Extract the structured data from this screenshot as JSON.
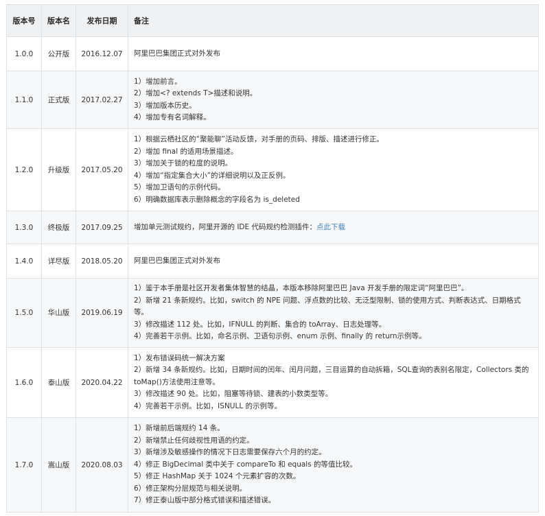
{
  "headers": {
    "version": "版本号",
    "name": "版本名",
    "date": "发布日期",
    "note": "备注"
  },
  "rows": [
    {
      "version": "1.0.0",
      "name": "公开版",
      "date": "2016.12.07",
      "notes": [
        "阿里巴巴集团正式对外发布"
      ]
    },
    {
      "version": "1.1.0",
      "name": "正式版",
      "date": "2017.02.27",
      "notes": [
        "1）增加前言。",
        "2）增加<? extends T>描述和说明。",
        "3）增加版本历史。",
        "4）增加专有名词解释。"
      ]
    },
    {
      "version": "1.2.0",
      "name": "升级版",
      "date": "2017.05.20",
      "notes": [
        "1）根据云栖社区的“聚能聊”活动反馈，对手册的页码、排版、描述进行修正。",
        "2）增加 final 的适用场景描述。",
        "3）增加关于锁的粒度的说明。",
        "4）增加“指定集合大小”的详细说明以及正反例。",
        "5）增加卫语句的示例代码。",
        "6）明确数据库表示删除概念的字段名为 is_deleted"
      ]
    },
    {
      "version": "1.3.0",
      "name": "终极版",
      "date": "2017.09.25",
      "notes": [
        "增加单元测试规约，阿里开源的 IDE 代码规约检测插件："
      ],
      "link": "点此下载"
    },
    {
      "version": "1.4.0",
      "name": "详尽版",
      "date": "2018.05.20",
      "notes": [
        "阿里巴巴集团正式对外发布"
      ]
    },
    {
      "version": "1.5.0",
      "name": "华山版",
      "date": "2019.06.19",
      "notes": [
        "1）鉴于本手册是社区开发者集体智慧的结晶，本版本移除阿里巴巴 Java 开发手册的限定词“阿里巴巴”。",
        "2）新增 21 条新规约。比如，switch 的 NPE 问题、浮点数的比较、无泛型限制、锁的使用方式、判断表达式、日期格式等。",
        "3）修改描述 112 处。比如，IFNULL 的判断、集合的 toArray、日志处理等。",
        "4）完善若干示例。比如，命名示例、卫语句示例、enum 示例、finally 的 return示例等。"
      ]
    },
    {
      "version": "1.6.0",
      "name": "泰山版",
      "date": "2020.04.22",
      "notes": [
        "1）发布错误码统一解决方案",
        "2）新增 34 条新规约。比如，日期时间的闰年、闰月问题，三目运算的自动拆箱，SQL查询的表别名限定，Collectors 类的 toMap()方法使用注意等。",
        "3）修改描述 90 处。比如，阻塞等待锁、建表的小数类型等。",
        "4）完善若干示例。比如，ISNULL 的示例等。"
      ]
    },
    {
      "version": "1.7.0",
      "name": "嵩山版",
      "date": "2020.08.03",
      "notes": [
        "1）新增前后端规约 14 条。",
        "2）新增禁止任何歧视性用语的约定。",
        "3）新增涉及敏感操作的情况下日志需要保存六个月的约定。",
        "4）修正 BigDecimal 类中关于 compareTo 和 equals 的等值比较。",
        "5）修正 HashMap 关于 1024 个元素扩容的次数。",
        "6）修正架构分层规范与相关说明。",
        "7）修正泰山版中部分格式错误和描述错误。"
      ]
    }
  ]
}
